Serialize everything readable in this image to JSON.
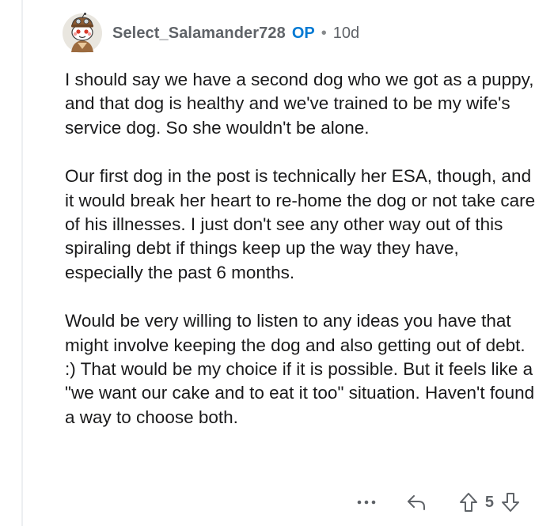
{
  "comment": {
    "username": "Select_Salamander728",
    "op_badge": "OP",
    "separator": "•",
    "age": "10d",
    "paragraphs": [
      "I should say we have a second dog who we got as a puppy, and that dog is healthy and we've trained to be my wife's service dog. So she wouldn't be alone.",
      "Our first dog in the post is technically her ESA, though, and it would break her heart to re-home the dog or not take care of his illnesses. I just don't see any other way out of this spiraling debt if things keep up the way they have, especially the past 6 months.",
      "Would be very willing to listen to any ideas you have that might involve keeping the dog and also getting out of debt. :) That would be my choice if it is possible. But it feels like a \"we want our cake and to eat it too\" situation. Haven't found a way to choose both."
    ],
    "score": "5"
  },
  "icons": {
    "avatar": "snoo-avatar",
    "more": "more-options-icon",
    "reply": "reply-icon",
    "upvote": "upvote-arrow-icon",
    "downvote": "downvote-arrow-icon"
  },
  "colors": {
    "op_badge": "#0079d3",
    "meta_text": "#5f6368",
    "body_text": "#1a1a1b",
    "thread_line": "#edeff1"
  }
}
